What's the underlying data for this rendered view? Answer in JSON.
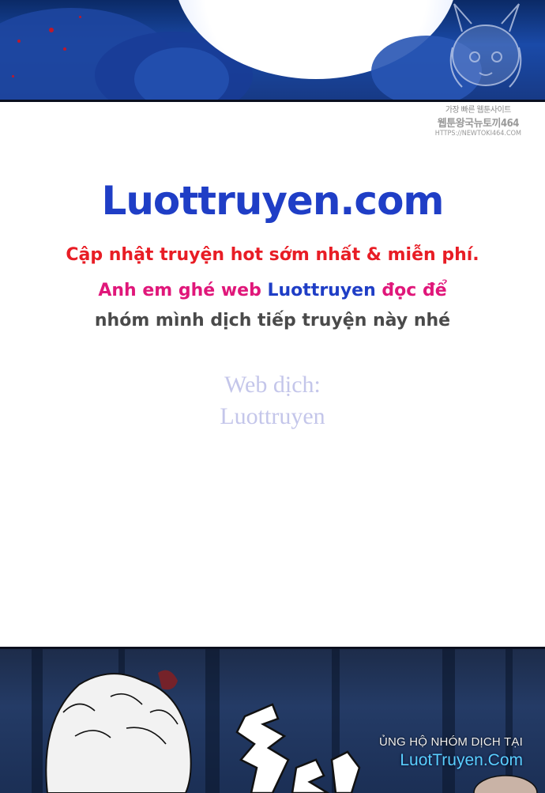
{
  "watermark_kr": {
    "line1": "가장 빠른 웹툰사이트",
    "line2": "웹툰왕국뉴토끼464",
    "line3": "HTTPS://NEWTOKI464.COM"
  },
  "site": {
    "title": "Luottruyen.com",
    "color_title": "#1f3ec6"
  },
  "promo_text": {
    "line1": "Cập nhật truyện hot sớm nhất & miễn phí.",
    "line2_prefix": "Anh em ghé web ",
    "line2_brand": "Luottruyen",
    "line2_suffix": " đọc để",
    "line3": "nhóm mình dịch tiếp truyện này nhé"
  },
  "credit": {
    "label": "Web dịch:",
    "name": "Luottruyen"
  },
  "footer_promo": {
    "line1": "ỦNG HỘ NHÓM DỊCH TẠI",
    "line2": "LuotTruyen.Com"
  }
}
